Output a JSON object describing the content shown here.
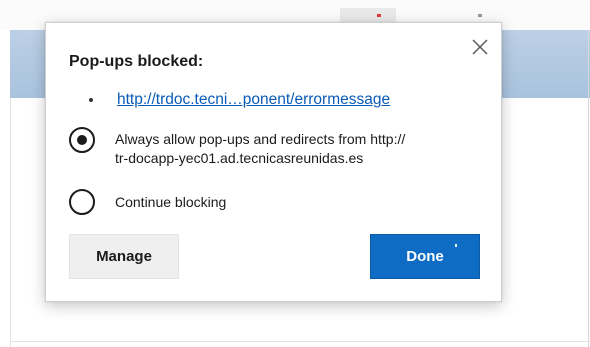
{
  "browser": {
    "tab_icon": "tab-favicon",
    "accent_color": "#0f6cc5"
  },
  "flyout": {
    "title": "Pop-ups blocked:",
    "close_icon": "close-icon",
    "blocked_urls": [
      "http://trdoc.tecni…ponent/errormessage"
    ],
    "options": [
      {
        "label_line1": "Always allow pop-ups and redirects from http://",
        "label_line2": "tr-docapp-yec01.ad.tecnicasreunidas.es",
        "selected": true
      },
      {
        "label_line1": "Continue blocking",
        "selected": false
      }
    ],
    "buttons": {
      "manage_label": "Manage",
      "done_label": "Done"
    }
  }
}
